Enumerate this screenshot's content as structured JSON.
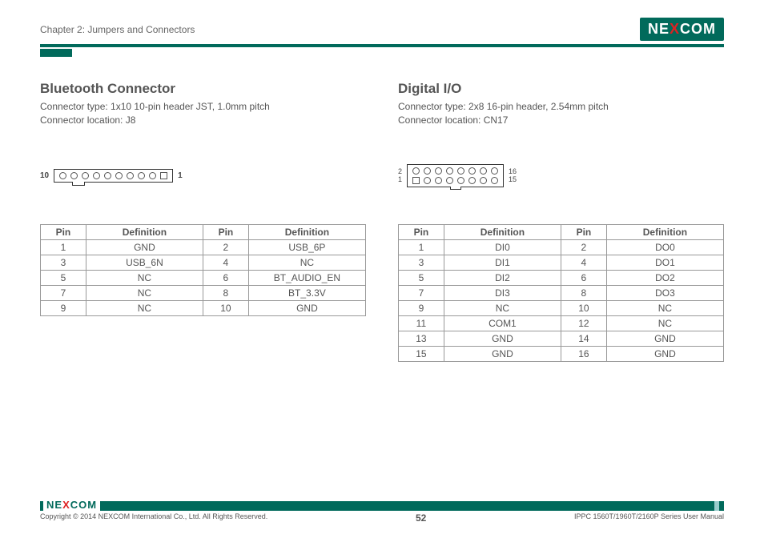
{
  "header": {
    "chapter": "Chapter 2: Jumpers and Connectors",
    "logo_pre": "NE",
    "logo_x": "X",
    "logo_post": "COM"
  },
  "left": {
    "title": "Bluetooth Connector",
    "conn_type": "Connector type: 1x10 10-pin header JST, 1.0mm pitch",
    "conn_loc": "Connector location: J8",
    "pin_left_label": "10",
    "pin_right_label": "1",
    "table": {
      "headers": [
        "Pin",
        "Definition",
        "Pin",
        "Definition"
      ],
      "rows": [
        [
          "1",
          "GND",
          "2",
          "USB_6P"
        ],
        [
          "3",
          "USB_6N",
          "4",
          "NC"
        ],
        [
          "5",
          "NC",
          "6",
          "BT_AUDIO_EN"
        ],
        [
          "7",
          "NC",
          "8",
          "BT_3.3V"
        ],
        [
          "9",
          "NC",
          "10",
          "GND"
        ]
      ]
    }
  },
  "right": {
    "title": "Digital I/O",
    "conn_type": "Connector type: 2x8 16-pin header, 2.54mm pitch",
    "conn_loc": "Connector location: CN17",
    "labels_left_top": "2",
    "labels_left_bot": "1",
    "labels_right_top": "16",
    "labels_right_bot": "15",
    "table": {
      "headers": [
        "Pin",
        "Definition",
        "Pin",
        "Definition"
      ],
      "rows": [
        [
          "1",
          "DI0",
          "2",
          "DO0"
        ],
        [
          "3",
          "DI1",
          "4",
          "DO1"
        ],
        [
          "5",
          "DI2",
          "6",
          "DO2"
        ],
        [
          "7",
          "DI3",
          "8",
          "DO3"
        ],
        [
          "9",
          "NC",
          "10",
          "NC"
        ],
        [
          "11",
          "COM1",
          "12",
          "NC"
        ],
        [
          "13",
          "GND",
          "14",
          "GND"
        ],
        [
          "15",
          "GND",
          "16",
          "GND"
        ]
      ]
    }
  },
  "footer": {
    "copyright": "Copyright © 2014 NEXCOM International Co., Ltd. All Rights Reserved.",
    "page": "52",
    "manual": "IPPC 1560T/1960T/2160P Series User Manual"
  }
}
